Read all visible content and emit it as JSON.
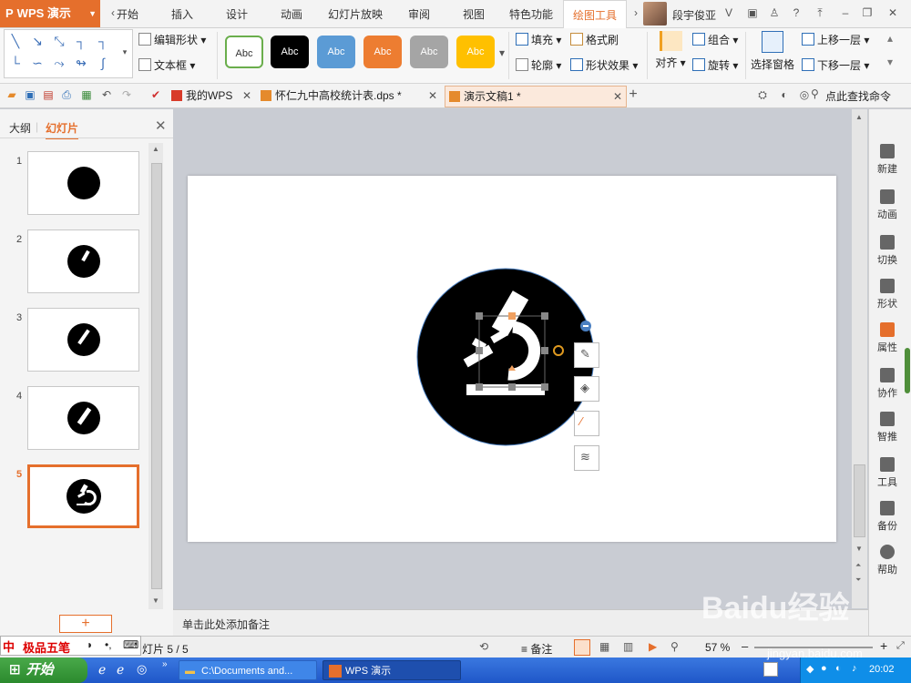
{
  "app": {
    "name": "WPS 演示",
    "accent": "#e56f2c"
  },
  "menubar": {
    "tabs": [
      "开始",
      "插入",
      "设计",
      "动画",
      "幻灯片放映",
      "审阅",
      "视图",
      "特色功能",
      "绘图工具"
    ],
    "active_tab": "绘图工具",
    "user": "段宇俊亚"
  },
  "ribbon": {
    "edit_shape": "编辑形状",
    "textbox": "文本框",
    "styles": [
      "Abc",
      "Abc",
      "Abc",
      "Abc",
      "Abc",
      "Abc"
    ],
    "fill": "填充",
    "format_painter": "格式刷",
    "outline": "轮廓",
    "shape_effects": "形状效果",
    "align": "对齐",
    "group": "组合",
    "rotate": "旋转",
    "select_pane": "选择窗格",
    "bring_forward": "上移一层",
    "send_backward": "下移一层"
  },
  "doctabs": {
    "mywps": "我的WPS",
    "file1": "怀仁九中高校统计表.dps *",
    "file2": "演示文稿1 *",
    "search": "点此查找命令"
  },
  "leftpanel": {
    "tab_outline": "大纲",
    "tab_slides": "幻灯片",
    "slides": [
      "1",
      "2",
      "3",
      "4",
      "5"
    ],
    "selected": "5"
  },
  "notes": {
    "placeholder": "单击此处添加备注"
  },
  "rightpanel": [
    "新建",
    "动画",
    "切换",
    "形状",
    "属性",
    "协作",
    "智推",
    "工具",
    "备份",
    "帮助"
  ],
  "status": {
    "ime": "极品五笔",
    "slide_info": "灯片 5 / 5",
    "notes_btn": "备注",
    "zoom": "57 %"
  },
  "taskbar": {
    "start": "开始",
    "task1": "C:\\Documents and...",
    "task2": "WPS 演示",
    "clock": "20:02"
  },
  "watermark": {
    "brand": "Baidu经验",
    "url": "jingyan.baidu.com"
  }
}
